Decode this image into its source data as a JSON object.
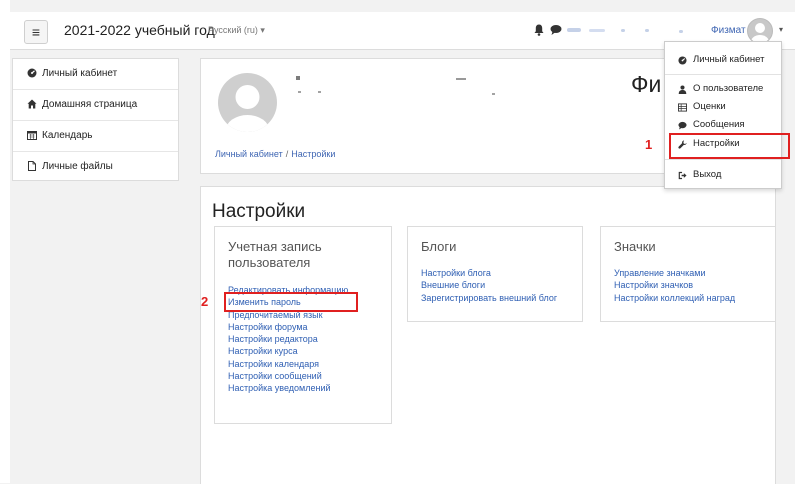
{
  "navbar": {
    "site_title": "2021-2022 учебный год",
    "language": "Русский (ru) ▾",
    "user_short": "Физмат",
    "caret": "▾",
    "menu_glyph": "≡"
  },
  "drawer": {
    "items": [
      {
        "label": "Личный кабинет",
        "icon": "dashboard-icon"
      },
      {
        "label": "Домашняя страница",
        "icon": "home-icon"
      },
      {
        "label": "Календарь",
        "icon": "calendar-icon"
      },
      {
        "label": "Личные файлы",
        "icon": "file-icon"
      }
    ]
  },
  "header": {
    "name_visible": "Фи",
    "breadcrumb": {
      "home": "Личный кабинет",
      "separator": "/",
      "current": "Настройки"
    }
  },
  "main": {
    "heading": "Настройки",
    "account": {
      "title": "Учетная запись пользователя",
      "links": [
        "Редактировать информацию",
        "Изменить пароль",
        "Предпочитаемый язык",
        "Настройки форума",
        "Настройки редактора",
        "Настройки курса",
        "Настройки календаря",
        "Настройки сообщений",
        "Настройка уведомлений"
      ]
    },
    "blogs": {
      "title": "Блоги",
      "links": [
        "Настройки блога",
        "Внешние блоги",
        "Зарегистрировать внешний блог"
      ]
    },
    "badges": {
      "title": "Значки",
      "links": [
        "Управление значками",
        "Настройки значков",
        "Настройки коллекций наград"
      ]
    }
  },
  "user_menu": {
    "items": [
      {
        "label": "Личный кабинет",
        "icon": "dashboard-icon"
      },
      {
        "label": "О пользователе",
        "icon": "user-icon"
      },
      {
        "label": "Оценки",
        "icon": "grades-table-icon"
      },
      {
        "label": "Сообщения",
        "icon": "chat-bubble-icon"
      },
      {
        "label": "Настройки",
        "icon": "wrench-icon"
      },
      {
        "label": "Выход",
        "icon": "logout-icon"
      }
    ]
  },
  "annotations": {
    "first": "1",
    "second": "2",
    "color": "#e02020"
  },
  "colors": {
    "link": "#2f5fb3",
    "accent_red": "#e02020",
    "page_bg": "#f2f2f2"
  }
}
